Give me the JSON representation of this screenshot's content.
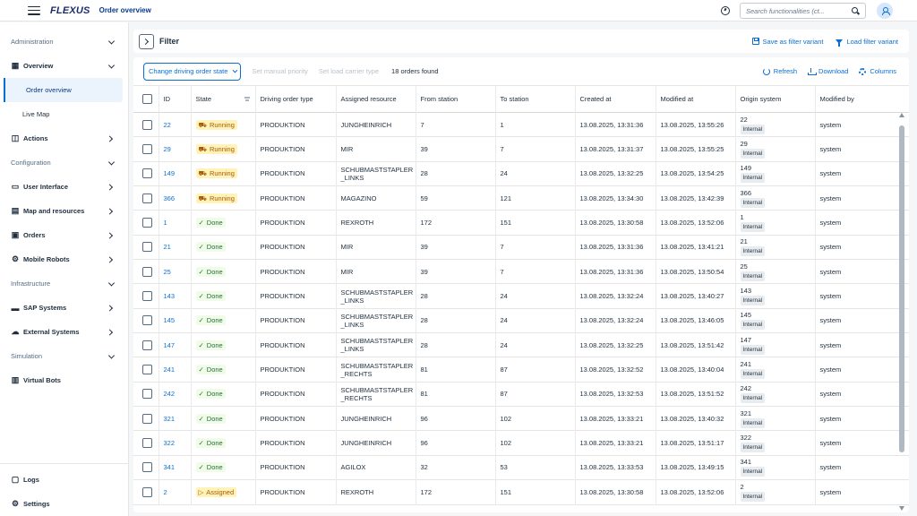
{
  "header": {
    "logo": "FLEXUS",
    "title": "Order overview",
    "search_placeholder": "Search functionalities (ct..."
  },
  "sidebar": {
    "groups": [
      {
        "label": "Administration"
      },
      {
        "label": "Configuration"
      },
      {
        "label": "Infrastructure"
      },
      {
        "label": "Simulation"
      }
    ],
    "items": {
      "overview": "Overview",
      "order_overview": "Order overview",
      "live_map": "Live Map",
      "actions": "Actions",
      "user_interface": "User Interface",
      "map_resources": "Map and resources",
      "orders": "Orders",
      "mobile_robots": "Mobile Robots",
      "sap_systems": "SAP Systems",
      "external_systems": "External Systems",
      "virtual_bots": "Virtual Bots",
      "logs": "Logs",
      "settings": "Settings"
    }
  },
  "filterbar": {
    "title": "Filter",
    "save_variant": "Save as filter variant",
    "load_variant": "Load filter variant"
  },
  "toolbar": {
    "change_priority_dd": "Change driving order state",
    "set_priority": "Set manual priority",
    "set_carrier": "Set load carrier type",
    "count": "18 orders found",
    "refresh": "Refresh",
    "download": "Download",
    "columns": "Columns"
  },
  "table": {
    "headers": {
      "id": "ID",
      "state": "State",
      "type": "Driving order type",
      "resource": "Assigned resource",
      "from": "From station",
      "to": "To station",
      "created": "Created at",
      "modified": "Modified at",
      "origin": "Origin system",
      "modified_by": "Modified by"
    },
    "rows": [
      {
        "id": "22",
        "state": "Running",
        "type": "PRODUKTION",
        "resource": "JUNGHEINRICH",
        "from": "7",
        "to": "1",
        "created": "13.08.2025, 13:31:36",
        "modified": "13.08.2025, 13:55:26",
        "origin": "22",
        "origin_tag": "Internal",
        "by": "system"
      },
      {
        "id": "29",
        "state": "Running",
        "type": "PRODUKTION",
        "resource": "MIR",
        "from": "39",
        "to": "7",
        "created": "13.08.2025, 13:31:37",
        "modified": "13.08.2025, 13:55:25",
        "origin": "29",
        "origin_tag": "Internal",
        "by": "system"
      },
      {
        "id": "149",
        "state": "Running",
        "type": "PRODUKTION",
        "resource": "SCHUBMASTSTAPLER\n_LINKS",
        "from": "28",
        "to": "24",
        "created": "13.08.2025, 13:32:25",
        "modified": "13.08.2025, 13:54:25",
        "origin": "149",
        "origin_tag": "Internal",
        "by": "system"
      },
      {
        "id": "366",
        "state": "Running",
        "type": "PRODUKTION",
        "resource": "MAGAZINO",
        "from": "59",
        "to": "121",
        "created": "13.08.2025, 13:34:30",
        "modified": "13.08.2025, 13:42:39",
        "origin": "366",
        "origin_tag": "Internal",
        "by": "system"
      },
      {
        "id": "1",
        "state": "Done",
        "type": "PRODUKTION",
        "resource": "REXROTH",
        "from": "172",
        "to": "151",
        "created": "13.08.2025, 13:30:58",
        "modified": "13.08.2025, 13:52:06",
        "origin": "1",
        "origin_tag": "Internal",
        "by": "system"
      },
      {
        "id": "21",
        "state": "Done",
        "type": "PRODUKTION",
        "resource": "MIR",
        "from": "39",
        "to": "7",
        "created": "13.08.2025, 13:31:36",
        "modified": "13.08.2025, 13:41:21",
        "origin": "21",
        "origin_tag": "Internal",
        "by": "system"
      },
      {
        "id": "25",
        "state": "Done",
        "type": "PRODUKTION",
        "resource": "MIR",
        "from": "39",
        "to": "7",
        "created": "13.08.2025, 13:31:36",
        "modified": "13.08.2025, 13:50:54",
        "origin": "25",
        "origin_tag": "Internal",
        "by": "system"
      },
      {
        "id": "143",
        "state": "Done",
        "type": "PRODUKTION",
        "resource": "SCHUBMASTSTAPLER\n_LINKS",
        "from": "28",
        "to": "24",
        "created": "13.08.2025, 13:32:24",
        "modified": "13.08.2025, 13:40:27",
        "origin": "143",
        "origin_tag": "Internal",
        "by": "system"
      },
      {
        "id": "145",
        "state": "Done",
        "type": "PRODUKTION",
        "resource": "SCHUBMASTSTAPLER\n_LINKS",
        "from": "28",
        "to": "24",
        "created": "13.08.2025, 13:32:24",
        "modified": "13.08.2025, 13:46:05",
        "origin": "145",
        "origin_tag": "Internal",
        "by": "system"
      },
      {
        "id": "147",
        "state": "Done",
        "type": "PRODUKTION",
        "resource": "SCHUBMASTSTAPLER\n_LINKS",
        "from": "28",
        "to": "24",
        "created": "13.08.2025, 13:32:25",
        "modified": "13.08.2025, 13:51:42",
        "origin": "147",
        "origin_tag": "Internal",
        "by": "system"
      },
      {
        "id": "241",
        "state": "Done",
        "type": "PRODUKTION",
        "resource": "SCHUBMASTSTAPLER\n_RECHTS",
        "from": "81",
        "to": "87",
        "created": "13.08.2025, 13:32:52",
        "modified": "13.08.2025, 13:40:04",
        "origin": "241",
        "origin_tag": "Internal",
        "by": "system"
      },
      {
        "id": "242",
        "state": "Done",
        "type": "PRODUKTION",
        "resource": "SCHUBMASTSTAPLER\n_RECHTS",
        "from": "81",
        "to": "87",
        "created": "13.08.2025, 13:32:53",
        "modified": "13.08.2025, 13:51:52",
        "origin": "242",
        "origin_tag": "Internal",
        "by": "system"
      },
      {
        "id": "321",
        "state": "Done",
        "type": "PRODUKTION",
        "resource": "JUNGHEINRICH",
        "from": "96",
        "to": "102",
        "created": "13.08.2025, 13:33:21",
        "modified": "13.08.2025, 13:40:32",
        "origin": "321",
        "origin_tag": "Internal",
        "by": "system"
      },
      {
        "id": "322",
        "state": "Done",
        "type": "PRODUKTION",
        "resource": "JUNGHEINRICH",
        "from": "96",
        "to": "102",
        "created": "13.08.2025, 13:33:21",
        "modified": "13.08.2025, 13:51:17",
        "origin": "322",
        "origin_tag": "Internal",
        "by": "system"
      },
      {
        "id": "341",
        "state": "Done",
        "type": "PRODUKTION",
        "resource": "AGILOX",
        "from": "32",
        "to": "53",
        "created": "13.08.2025, 13:33:53",
        "modified": "13.08.2025, 13:49:15",
        "origin": "341",
        "origin_tag": "Internal",
        "by": "system"
      },
      {
        "id": "2",
        "state": "Assigned",
        "type": "PRODUKTION",
        "resource": "REXROTH",
        "from": "172",
        "to": "151",
        "created": "13.08.2025, 13:30:58",
        "modified": "13.08.2025, 13:52:06",
        "origin": "2",
        "origin_tag": "Internal",
        "by": "system"
      }
    ]
  },
  "colors": {
    "accent": "#0a6ed1",
    "running_bg": "#fff3b8",
    "done_bg": "#f0fce8"
  }
}
